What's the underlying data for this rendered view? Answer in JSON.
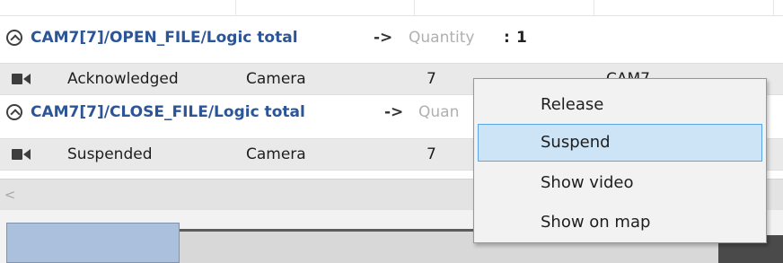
{
  "groups": [
    {
      "title": "CAM7[7]/OPEN_FILE/Logic total",
      "arrow": "->",
      "quantity_label": "Quantity",
      "quantity_sep": ":",
      "quantity_value": "1",
      "row": {
        "state": "Acknowledged",
        "type": "Camera",
        "id": "7",
        "name": "CAM7"
      }
    },
    {
      "title": "CAM7[7]/CLOSE_FILE/Logic total",
      "arrow": "->",
      "quantity_label": "Quan",
      "row": {
        "state": "Suspended",
        "type": "Camera",
        "id": "7"
      }
    }
  ],
  "scrollbar": {
    "left_arrow": "<"
  },
  "context_menu": {
    "items": [
      {
        "label": "Release"
      },
      {
        "label": "Suspend",
        "highlighted": true
      },
      {
        "label": "Show video"
      },
      {
        "label": "Show on map"
      }
    ]
  },
  "colors": {
    "group_title": "#2c5597",
    "row_background": "#e9e9e9",
    "menu_highlight": "#cde4f7",
    "menu_highlight_border": "#58a6e8"
  },
  "icons": {
    "row_icon": "video-camera-icon",
    "group_toggle": "collapse-chevron-icon"
  }
}
